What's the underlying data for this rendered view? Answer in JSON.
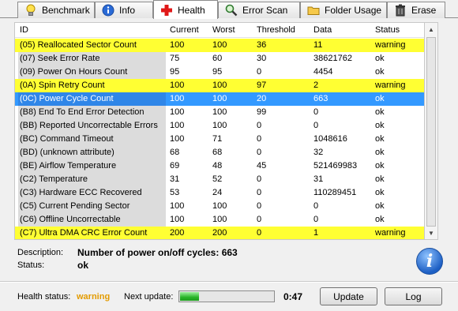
{
  "tabs": [
    {
      "label": "Benchmark",
      "icon": "bulb-icon"
    },
    {
      "label": "Info",
      "icon": "info-icon"
    },
    {
      "label": "Health",
      "icon": "red-cross-icon",
      "active": true
    },
    {
      "label": "Error Scan",
      "icon": "magnifier-icon"
    },
    {
      "label": "Folder Usage",
      "icon": "folder-icon"
    },
    {
      "label": "Erase",
      "icon": "trash-icon"
    }
  ],
  "table": {
    "columns": [
      "ID",
      "Current",
      "Worst",
      "Threshold",
      "Data",
      "Status"
    ],
    "rows": [
      {
        "id": "(05) Reallocated Sector Count",
        "current": "100",
        "worst": "100",
        "threshold": "36",
        "data": "11",
        "status": "warning",
        "state": "warning"
      },
      {
        "id": "(07) Seek Error Rate",
        "current": "75",
        "worst": "60",
        "threshold": "30",
        "data": "38621762",
        "status": "ok",
        "state": "normal"
      },
      {
        "id": "(09) Power On Hours Count",
        "current": "95",
        "worst": "95",
        "threshold": "0",
        "data": "4454",
        "status": "ok",
        "state": "normal"
      },
      {
        "id": "(0A) Spin Retry Count",
        "current": "100",
        "worst": "100",
        "threshold": "97",
        "data": "2",
        "status": "warning",
        "state": "warning"
      },
      {
        "id": "(0C) Power Cycle Count",
        "current": "100",
        "worst": "100",
        "threshold": "20",
        "data": "663",
        "status": "ok",
        "state": "selected"
      },
      {
        "id": "(B8) End To End Error Detection",
        "current": "100",
        "worst": "100",
        "threshold": "99",
        "data": "0",
        "status": "ok",
        "state": "normal"
      },
      {
        "id": "(BB) Reported Uncorrectable Errors",
        "current": "100",
        "worst": "100",
        "threshold": "0",
        "data": "0",
        "status": "ok",
        "state": "normal"
      },
      {
        "id": "(BC) Command Timeout",
        "current": "100",
        "worst": "71",
        "threshold": "0",
        "data": "1048616",
        "status": "ok",
        "state": "normal"
      },
      {
        "id": "(BD) (unknown attribute)",
        "current": "68",
        "worst": "68",
        "threshold": "0",
        "data": "32",
        "status": "ok",
        "state": "normal"
      },
      {
        "id": "(BE) Airflow Temperature",
        "current": "69",
        "worst": "48",
        "threshold": "45",
        "data": "521469983",
        "status": "ok",
        "state": "normal"
      },
      {
        "id": "(C2) Temperature",
        "current": "31",
        "worst": "52",
        "threshold": "0",
        "data": "31",
        "status": "ok",
        "state": "normal"
      },
      {
        "id": "(C3) Hardware ECC Recovered",
        "current": "53",
        "worst": "24",
        "threshold": "0",
        "data": "110289451",
        "status": "ok",
        "state": "normal"
      },
      {
        "id": "(C5) Current Pending Sector",
        "current": "100",
        "worst": "100",
        "threshold": "0",
        "data": "0",
        "status": "ok",
        "state": "normal"
      },
      {
        "id": "(C6) Offline Uncorrectable",
        "current": "100",
        "worst": "100",
        "threshold": "0",
        "data": "0",
        "status": "ok",
        "state": "normal"
      },
      {
        "id": "(C7) Ultra DMA CRC Error Count",
        "current": "200",
        "worst": "200",
        "threshold": "0",
        "data": "1",
        "status": "warning",
        "state": "warning"
      }
    ]
  },
  "details": {
    "description_label": "Description:",
    "description_value": "Number of power on/off cycles: 663",
    "status_label": "Status:",
    "status_value": "ok"
  },
  "footer": {
    "health_label": "Health status:",
    "health_value": "warning",
    "next_update_label": "Next update:",
    "progress_fraction": 0.2,
    "timer": "0:47",
    "update_button": "Update",
    "log_button": "Log"
  },
  "colors": {
    "warning_row": "#ffff33",
    "selected_row": "#3399ff",
    "health_warning_text": "#e39b00",
    "progress_fill": "#28b428"
  }
}
